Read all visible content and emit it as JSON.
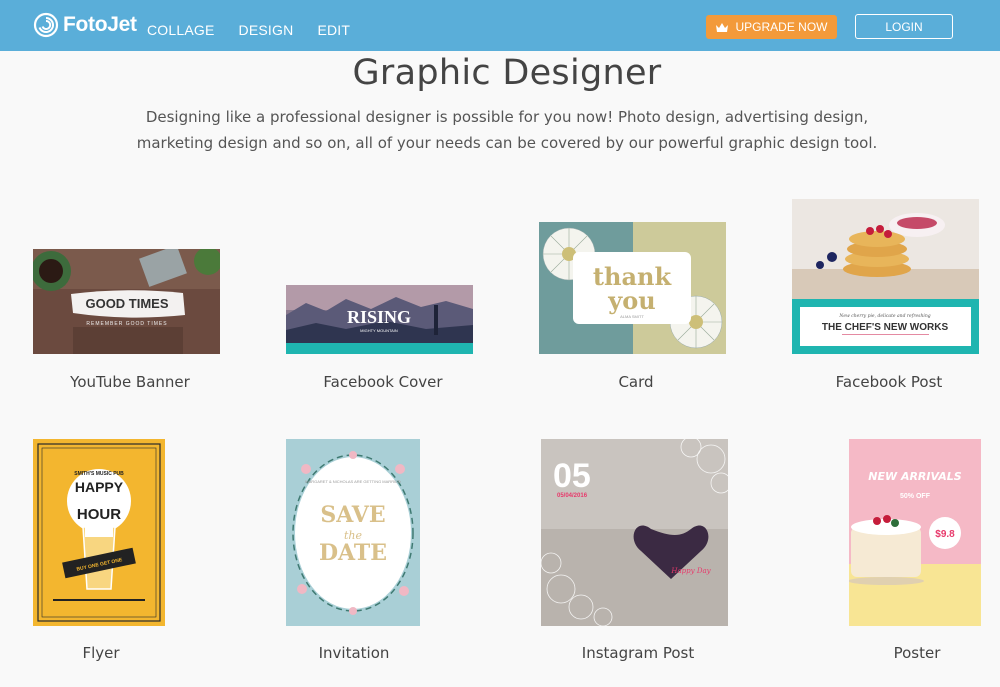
{
  "header": {
    "brand": "FotoJet",
    "nav": [
      "COLLAGE",
      "DESIGN",
      "EDIT"
    ],
    "upgrade_label": "UPGRADE NOW",
    "login_label": "LOGIN"
  },
  "hero": {
    "title": "Graphic Designer",
    "description": "Designing like a professional designer is possible for you now! Photo design, advertising design, marketing design and so on, all of your needs can be covered by our powerful graphic design tool."
  },
  "templates": [
    {
      "label": "YouTube Banner",
      "text": "GOOD TIMES",
      "subtext": "REMEMBER GOOD TIMES"
    },
    {
      "label": "Facebook Cover",
      "text": "RISING",
      "subtext": "MIGHTY MOUNTAIN"
    },
    {
      "label": "Card",
      "text": "thank",
      "text2": "you",
      "subtext": "ALMA SMITT"
    },
    {
      "label": "Facebook Post",
      "text": "THE CHEF'S NEW WORKS",
      "subtext": "New cherry pie, delicate and refreshing"
    },
    {
      "label": "Flyer",
      "text": "HAPPY",
      "text2": "HOUR",
      "subtext": "SMITH'S MUSIC PUB",
      "badge": "BUY ONE GET ONE"
    },
    {
      "label": "Invitation",
      "text": "SAVE",
      "text2": "the",
      "text3": "DATE",
      "subtext": "MARGARET & NICHOLAS ARE GETTING MARRIED"
    },
    {
      "label": "Instagram Post",
      "text": "05",
      "subtext": "05/04/2016",
      "script": "Happy Day"
    },
    {
      "label": "Poster",
      "text": "NEW ARRIVALS",
      "subtext": "50% OFF",
      "price": "$9.8"
    }
  ],
  "colors": {
    "header": "#5aaed9",
    "upgrade": "#f39a3a",
    "teal": "#1fb5b0"
  }
}
